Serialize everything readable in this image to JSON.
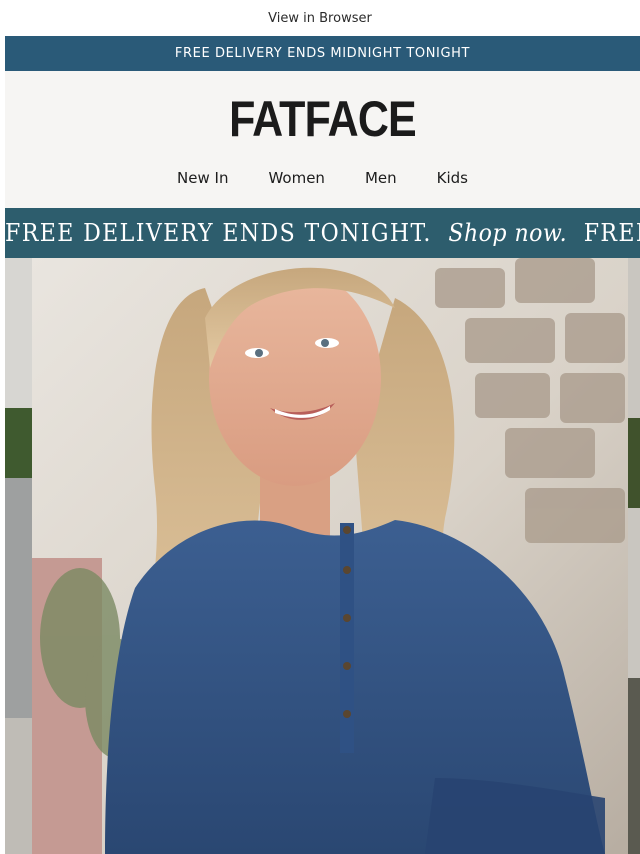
{
  "top_link": "View in Browser",
  "promo_bar": "FREE DELIVERY ENDS MIDNIGHT TONIGHT",
  "brand": {
    "logo": "FATFACE"
  },
  "nav": [
    {
      "label": "New In"
    },
    {
      "label": "Women"
    },
    {
      "label": "Men"
    },
    {
      "label": "Kids"
    }
  ],
  "ticker": {
    "text": "FREE DELIVERY ENDS TONIGHT.",
    "cta": "Shop now.",
    "text_repeat": "FREE DELIVERY ENDS TONIGHT."
  },
  "colors": {
    "promo_bar": "#2a5a78",
    "ticker_bar": "#2d5d6d",
    "header_bg": "#f6f5f3"
  }
}
